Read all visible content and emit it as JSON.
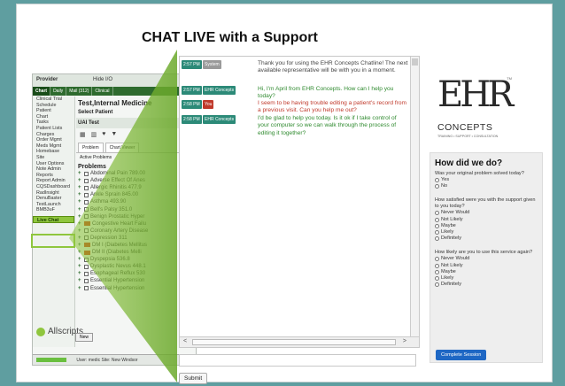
{
  "headline": "CHAT LIVE with a Support",
  "ehr_window": {
    "provider_label": "Provider",
    "hide_label": "Hide I/O",
    "tabs": [
      "Chart",
      "Daily",
      "Mail (312)",
      "Clinical"
    ],
    "patient_title": "Test,Internal Medicine",
    "select_patient_label": "Select Patient",
    "uai_label": "UAI Test",
    "sub_tabs": [
      "Problem",
      "Chart Viewer"
    ],
    "active_problems_label": "Active Problems",
    "problems_header": "Problems",
    "problems": [
      "Abdominal Pain 789.00",
      "Adverse Effect Of Anes",
      "Allergic Rhinitis 477.9",
      "Ankle Sprain 845.00",
      "Asthma 493.90",
      "Bell's Palsy 351.0",
      "Benign Prostatic Hyper",
      "Congestive Heart Failu",
      "Coronary Artery Disease",
      "Depression 311",
      "DM I (Diabetes Mellitus",
      "DM II (Diabetes Melli",
      "Dyspepsia 536.8",
      "Dysplastic Nevus 448.1",
      "Esophageal Reflux 530",
      "Essential Hypertension",
      "Essential Hypertension"
    ],
    "new_label": "New",
    "brand": "Allscripts",
    "status_text": "User: medic  Site: New Windsor",
    "nav_items": [
      "Clinical Trial",
      "Schedule",
      "Patient",
      "Chart",
      "Tasks",
      "Patient Lists",
      "Charges",
      "Order Mgmt",
      "Meds Mgmt",
      "Homebase",
      "Site",
      "User Options",
      "Note Admin",
      "Reports",
      "Report Admin",
      "CQSDashboard",
      "RadInsight",
      "DenuBaster",
      "TestLaunch",
      "BMB3uF"
    ],
    "live_chat_label": "Live Chat"
  },
  "chat": {
    "messages": [
      {
        "time": "2:57 PM",
        "who": "System",
        "who_color": "#9a9a9a",
        "text_color": "#444444",
        "text": "Thank you for using the EHR Concepts Chatline! The next available representative will be with you in a moment."
      },
      {
        "time": "2:57 PM",
        "who": "EHR Concepts",
        "who_color": "#2c8a78",
        "text_color": "#2f8a2f",
        "text": "Hi, I'm April from EHR Concepts. How can I help you today?"
      },
      {
        "time": "2:58 PM",
        "who": "You",
        "who_color": "#c0392b",
        "text_color": "#c0392b",
        "text": "I seem to be having trouble editing a patient's record from a previous visit. Can you help me out?"
      },
      {
        "time": "2:58 PM",
        "who": "EHR Concepts",
        "who_color": "#2c8a78",
        "text_color": "#2f8a2f",
        "text": "I'd be glad to help you today. Is it ok if I take control of your computer so we can walk through the process of editing it together?"
      }
    ],
    "input_value": "",
    "submit_label": "Submit"
  },
  "logo": {
    "letters": "EHR",
    "concepts": "CONCEPTS",
    "tagline": "TRAINING • SUPPORT • CONSULTATION",
    "tm": "TM"
  },
  "survey": {
    "title": "How did we do?",
    "questions": [
      {
        "text": "Was your original problem solved today?",
        "options": [
          "Yes",
          "No"
        ]
      },
      {
        "text": "How satisfied were you with the support given to you today?",
        "options": [
          "Never Would",
          "Not Likely",
          "Maybe",
          "Likely",
          "Definitely"
        ]
      },
      {
        "text": "How likely are you to use this service again?",
        "options": [
          "Never Would",
          "Not Likely",
          "Maybe",
          "Likely",
          "Definitely"
        ]
      }
    ],
    "complete_label": "Complete Session"
  },
  "colors": {
    "background": "#5f9ea0",
    "ehr_green": "#2e6b2e",
    "highlight_green": "#8fc63e",
    "button_blue": "#1e67c4"
  }
}
